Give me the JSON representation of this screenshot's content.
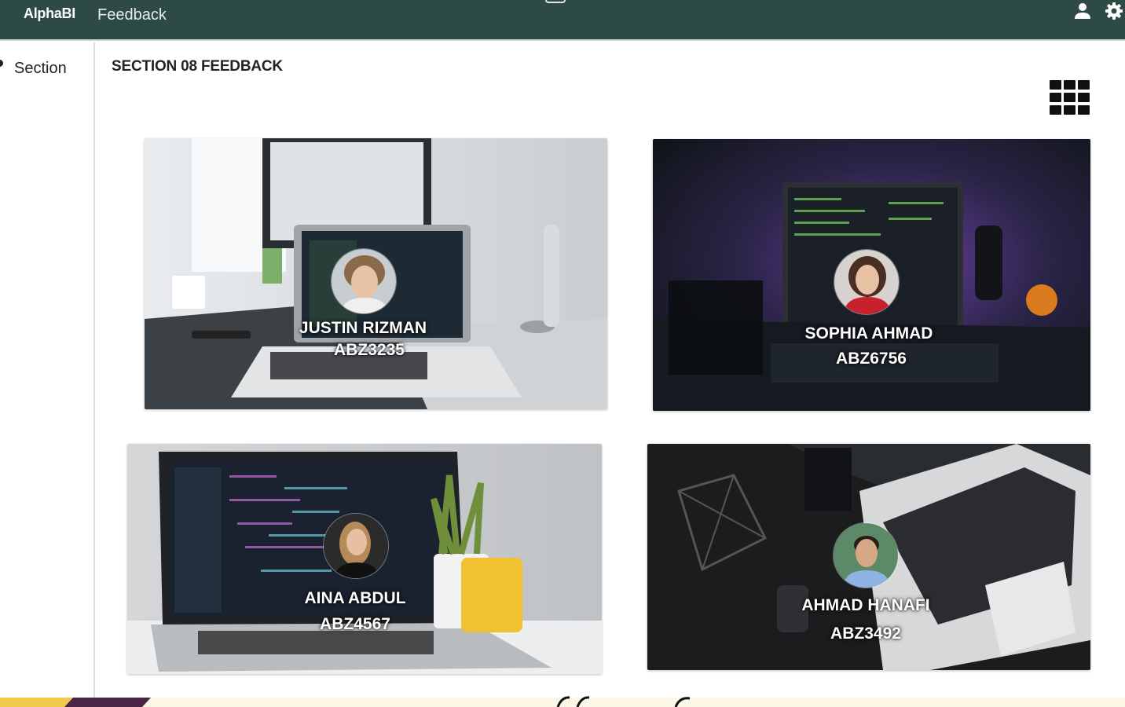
{
  "app": {
    "brand": "AlphaBI",
    "page": "Feedback"
  },
  "sidebar": {
    "items": [
      {
        "label": "Section"
      }
    ]
  },
  "main": {
    "title": "SECTION 08 FEEDBACK",
    "view_toggle_icon": "grid-icon",
    "cards": [
      {
        "name": "JUSTIN RIZMAN",
        "id": "ABZ3235"
      },
      {
        "name": "SOPHIA AHMAD",
        "id": "ABZ6756"
      },
      {
        "name": "AINA ABDUL",
        "id": "ABZ4567"
      },
      {
        "name": "AHMAD HANAFI",
        "id": "ABZ3492"
      }
    ]
  },
  "icons": {
    "user": "user-icon",
    "settings": "gear-icon"
  },
  "colors": {
    "topbar": "#2e4a45",
    "footer_yellow": "#f2c94c",
    "footer_purple": "#4a2445"
  }
}
